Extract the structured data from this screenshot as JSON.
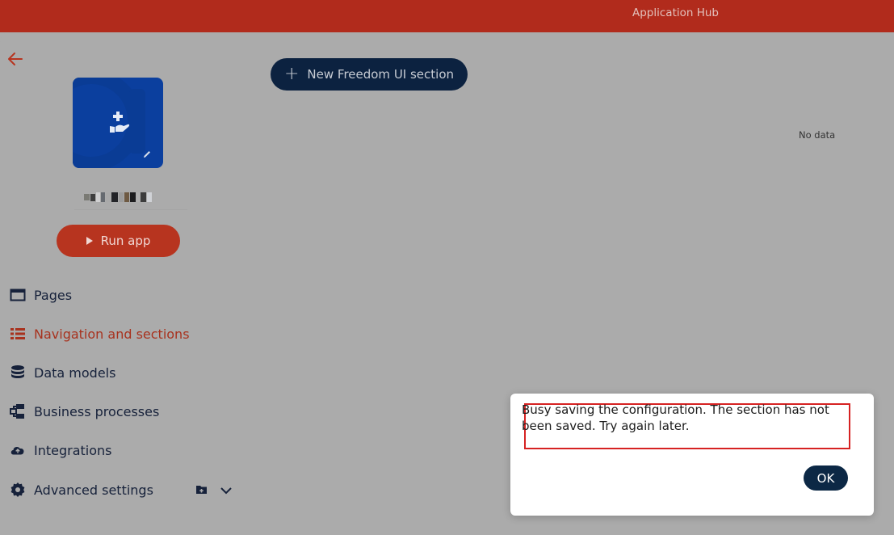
{
  "header": {
    "title": "Application Hub"
  },
  "sidebar": {
    "run_button_label": "Run app",
    "items": [
      {
        "label": "Pages",
        "icon": "window-icon"
      },
      {
        "label": "Navigation and sections",
        "icon": "list-icon",
        "active": true
      },
      {
        "label": "Data models",
        "icon": "database-icon"
      },
      {
        "label": "Business processes",
        "icon": "process-icon"
      },
      {
        "label": "Integrations",
        "icon": "cloud-icon"
      },
      {
        "label": "Advanced settings",
        "icon": "gear-icon"
      }
    ]
  },
  "main": {
    "new_section_label": "New Freedom UI section",
    "empty_text": "No data"
  },
  "dialog": {
    "message": "Busy saving the configuration. The section has not been saved. Try again later.",
    "ok_label": "OK"
  },
  "colors": {
    "header": "#b12b1c",
    "accent": "#b7341f",
    "primary_dark": "#0c2240",
    "app_tile": "#0b3f9e",
    "highlight_border": "#d62222"
  }
}
